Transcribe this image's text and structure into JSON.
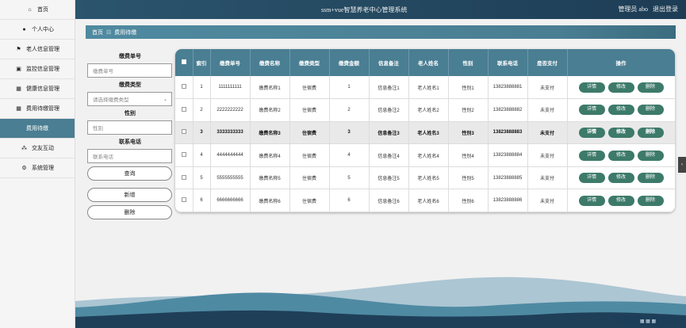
{
  "sidebar": {
    "items": [
      {
        "label": "首页",
        "icon": "home-icon",
        "glyph": "⌂"
      },
      {
        "label": "个人中心",
        "icon": "user-icon",
        "glyph": "●"
      },
      {
        "label": "老人信息管理",
        "icon": "flag-icon",
        "glyph": "⚑"
      },
      {
        "label": "监控信息管理",
        "icon": "monitor-icon",
        "glyph": "▣"
      },
      {
        "label": "健康信息管理",
        "icon": "grid-icon",
        "glyph": "▦"
      },
      {
        "label": "费用待缴管理",
        "icon": "grid-icon",
        "glyph": "▦"
      },
      {
        "label": "费用待缴",
        "icon": "",
        "glyph": ""
      },
      {
        "label": "交友互动",
        "icon": "people-icon",
        "glyph": "⁂"
      },
      {
        "label": "系统管理",
        "icon": "settings-icon",
        "glyph": "⚙"
      }
    ],
    "active_index": 6
  },
  "header": {
    "title": "ssm+vue智慧养老中心管理系统",
    "admin_label": "管理员 abo",
    "logout_label": "退出登录"
  },
  "breadcrumb": {
    "home": "首页",
    "sep": "☷",
    "current": "费用待缴"
  },
  "search": {
    "fields": [
      {
        "label": "缴费单号",
        "placeholder": "缴费单号",
        "type": "input"
      },
      {
        "label": "缴费类型",
        "placeholder": "请选择缴费类型",
        "type": "select"
      },
      {
        "label": "性别",
        "placeholder": "性别",
        "type": "input"
      },
      {
        "label": "联系电话",
        "placeholder": "联系电话",
        "type": "input"
      }
    ],
    "query_label": "查询",
    "add_label": "新增",
    "delete_label": "删除"
  },
  "table": {
    "columns": [
      "索引",
      "缴费单号",
      "缴费名称",
      "缴费类型",
      "缴费金额",
      "信息备注",
      "老人姓名",
      "性别",
      "联系电话",
      "是否支付",
      "操作"
    ],
    "rows": [
      [
        "1",
        "1111111111",
        "缴费名称1",
        "住宿费",
        "1",
        "信息备注1",
        "老人姓名1",
        "性别1",
        "13823888881",
        "未支付"
      ],
      [
        "2",
        "2222222222",
        "缴费名称2",
        "住宿费",
        "2",
        "信息备注2",
        "老人姓名2",
        "性别2",
        "13823888882",
        "未支付"
      ],
      [
        "3",
        "3333333333",
        "缴费名称3",
        "住宿费",
        "3",
        "信息备注3",
        "老人姓名3",
        "性别3",
        "13823888883",
        "未支付"
      ],
      [
        "4",
        "4444444444",
        "缴费名称4",
        "住宿费",
        "4",
        "信息备注4",
        "老人姓名4",
        "性别4",
        "13823888884",
        "未支付"
      ],
      [
        "5",
        "5555555555",
        "缴费名称5",
        "住宿费",
        "5",
        "信息备注5",
        "老人姓名5",
        "性别5",
        "13823888885",
        "未支付"
      ],
      [
        "6",
        "6666666666",
        "缴费名称6",
        "住宿费",
        "6",
        "信息备注6",
        "老人姓名6",
        "性别6",
        "13823888886",
        "未支付"
      ]
    ],
    "highlight_row": 2,
    "actions": [
      "详情",
      "修改",
      "删除"
    ]
  },
  "colors": {
    "accent": "#4a7e92",
    "action_button": "#3d7a6a",
    "topbar": "#2b556d"
  }
}
